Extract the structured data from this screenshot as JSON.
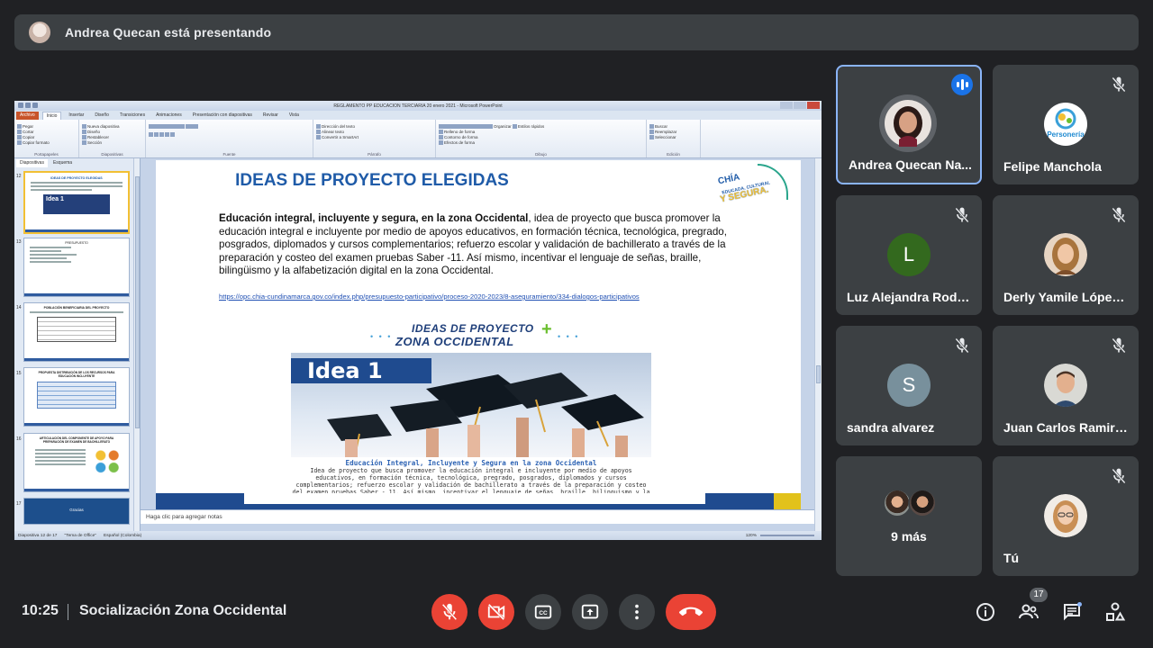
{
  "presenting_banner": {
    "text": "Andrea Quecan está presentando"
  },
  "powerpoint": {
    "window_title": "REGLAMENTO PP EDUCACION TERCIARIA 20 enero 2021 - Microsoft PowerPoint",
    "tabs": [
      "Archivo",
      "Inicio",
      "Insertar",
      "Diseño",
      "Transiciones",
      "Animaciones",
      "Presentación con diapositivas",
      "Revisar",
      "Vista"
    ],
    "ribbon": {
      "clipboard": {
        "paste": "Pegar",
        "cut": "Cortar",
        "copy": "Copiar",
        "format": "Copiar formato",
        "label": "Portapapeles"
      },
      "slides": {
        "new": "Nueva diapositiva",
        "layout": "Diseño",
        "reset": "Restablecer",
        "section": "Sección",
        "label": "Diapositivas"
      },
      "font_label": "Fuente",
      "paragraph": {
        "dir": "Dirección del texto",
        "align": "Alinear texto",
        "smartart": "Convertir a SmartArt",
        "label": "Párrafo"
      },
      "drawing": {
        "arrange": "Organizar",
        "styles": "Estilos rápidos",
        "fill": "Relleno de forma",
        "outline": "Contorno de forma",
        "effects": "Efectos de forma",
        "label": "Dibujo"
      },
      "editing": {
        "find": "Buscar",
        "replace": "Reemplazar",
        "select": "Seleccionar",
        "label": "Edición"
      }
    },
    "pane_tabs": [
      "Diapositivas",
      "Esquema"
    ],
    "thumb_numbers": [
      "12",
      "13",
      "14",
      "15",
      "16",
      "17"
    ],
    "thumbs": {
      "t12": {
        "title": "IDEAS DE PROYECTO ELEGIDAS",
        "idea": "Idea 1"
      },
      "t13": {
        "title": "PRESUPUESTO"
      },
      "t14": {
        "title": "POBLACIÓN BENEFICIARIA DEL PROYECTO"
      },
      "t15": {
        "title": "PROPUESTA DISTRIBUCIÓN DE LOS RECURSOS PARA EDUCACIÓN INCLUYENTE"
      },
      "t16": {
        "title": "ARTICULACIÓN DEL COMPONENTE DE APOYO PARA PREPARACIÓN DE EXAMEN DE BACHILLERATO"
      },
      "t17": {
        "title": "Gracias"
      }
    },
    "slide": {
      "title": "IDEAS DE PROYECTO ELEGIDAS",
      "logo": {
        "line1": "CHÍA",
        "line2": "EDUCADA, CULTURAL",
        "line3": "Y SEGURA."
      },
      "body_bold": "Educación integral, incluyente y segura, en la zona Occidental",
      "body_rest": ", idea de proyecto que busca promover la educación integral e incluyente por medio de apoyos educativos, en formación técnica, tecnológica, pregrado, posgrados, diplomados y cursos complementarios; refuerzo escolar y validación de bachillerato a través de la preparación y costeo del examen pruebas Saber -11. Así mismo, incentivar el lenguaje de señas, braille, bilingüismo y la alfabetización digital en la zona Occidental.",
      "link": "https://opc.chia-cundinamarca.gov.co/index.php/presupuesto-participativo/proceso-2020-2023/8-aseguramiento/334-dialogos-participativos",
      "banner_line1": "IDEAS DE PROYECTO",
      "banner_plus": "+",
      "banner_line2": "ZONA OCCIDENTAL",
      "idea_label": "Idea 1",
      "graphic_title": "Educación Integral, Incluyente y Segura en la zona Occidental",
      "graphic_body": "Idea de proyecto que busca promover la educación integral e incluyente por medio de apoyos educativos, en formación técnica, tecnológica, pregrado, posgrados, diplomados y cursos complementarios; refuerzo escolar y validación de bachillerato a través de la preparación y costeo del examen pruebas Saber - 11. Así mismo, incentivar el lenguaje de señas, braille, bilinguismo y la alfabetización digital en la zona Occidental."
    },
    "notes_placeholder": "Haga clic para agregar notas",
    "status": {
      "slide": "Diapositiva 12 de 17",
      "theme": "\"Tema de Office\"",
      "language": "Español (Colombia)",
      "zoom": "120%"
    }
  },
  "participants": [
    {
      "name": "Andrea Quecan Na...",
      "speaking": true
    },
    {
      "name": "Felipe Manchola",
      "muted": true,
      "avatar_text": "Personería"
    },
    {
      "name": "Luz Alejandra Rodr...",
      "muted": true,
      "initial": "L",
      "color": "#33691e"
    },
    {
      "name": "Derly Yamile López...",
      "muted": true
    },
    {
      "name": "sandra alvarez",
      "muted": true,
      "initial": "S",
      "color": "#78909c"
    },
    {
      "name": "Juan Carlos Ramirez",
      "muted": true
    },
    {
      "more": "9 más"
    },
    {
      "name": "Tú",
      "muted": true
    }
  ],
  "bottom_bar": {
    "time": "10:25",
    "meeting_name": "Socialización Zona Occidental",
    "participant_count": "17"
  },
  "colors": {
    "background": "#202124",
    "tile": "#3c4043",
    "danger": "#ea4335",
    "accent": "#8ab4f8"
  }
}
